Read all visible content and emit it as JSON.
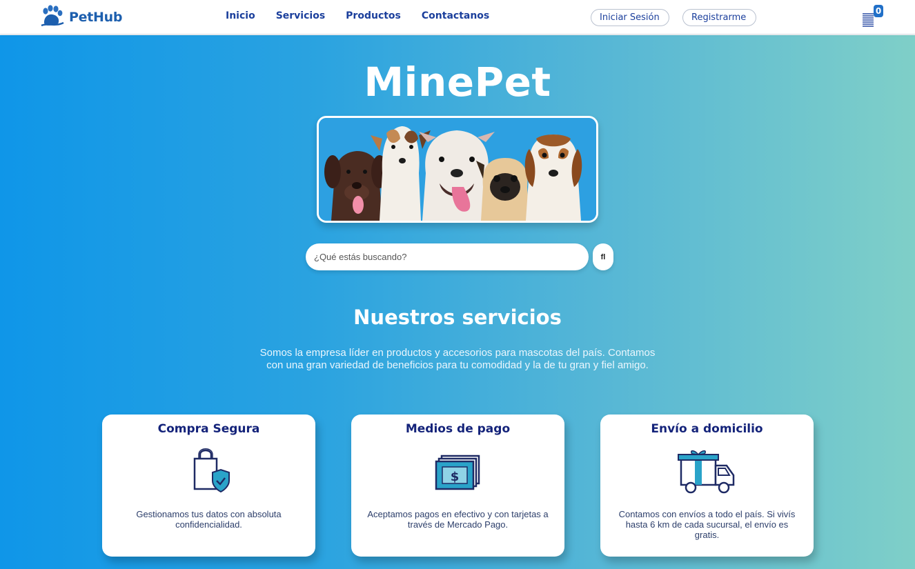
{
  "header": {
    "logo_text": "PetHub",
    "nav": [
      "Inicio",
      "Servicios",
      "Productos",
      "Contactanos"
    ],
    "login_label": "Iniciar Sesión",
    "register_label": "Registrarme",
    "cart_count": "0"
  },
  "hero": {
    "title": "MinePet",
    "search_placeholder": "¿Qué estás buscando?",
    "search_button_glyph": "fl"
  },
  "services": {
    "title": "Nuestros servicios",
    "description": "Somos la empresa líder en productos y accesorios para mascotas del país. Contamos con una gran variedad de beneficios para tu comodidad y la de tu gran y fiel amigo.",
    "cards": [
      {
        "title": "Compra Segura",
        "text": "Gestionamos tus datos con absoluta confidencialidad.",
        "icon": "shopping-bag-shield-icon"
      },
      {
        "title": "Medios de pago",
        "text": "Aceptamos pagos en efectivo y con tarjetas a través de Mercado Pago.",
        "icon": "cash-icon"
      },
      {
        "title": "Envío a domicilio",
        "text": "Contamos con envíos a todo el país. Si vivís hasta 6 km de cada sucursal, el envío es gratis.",
        "icon": "delivery-truck-icon"
      }
    ]
  },
  "colors": {
    "brand_blue": "#1d5fae",
    "nav_blue": "#1b3f9c",
    "card_title": "#14237a",
    "gradient_start": "#0f96e8",
    "gradient_end": "#7fcfc8"
  }
}
